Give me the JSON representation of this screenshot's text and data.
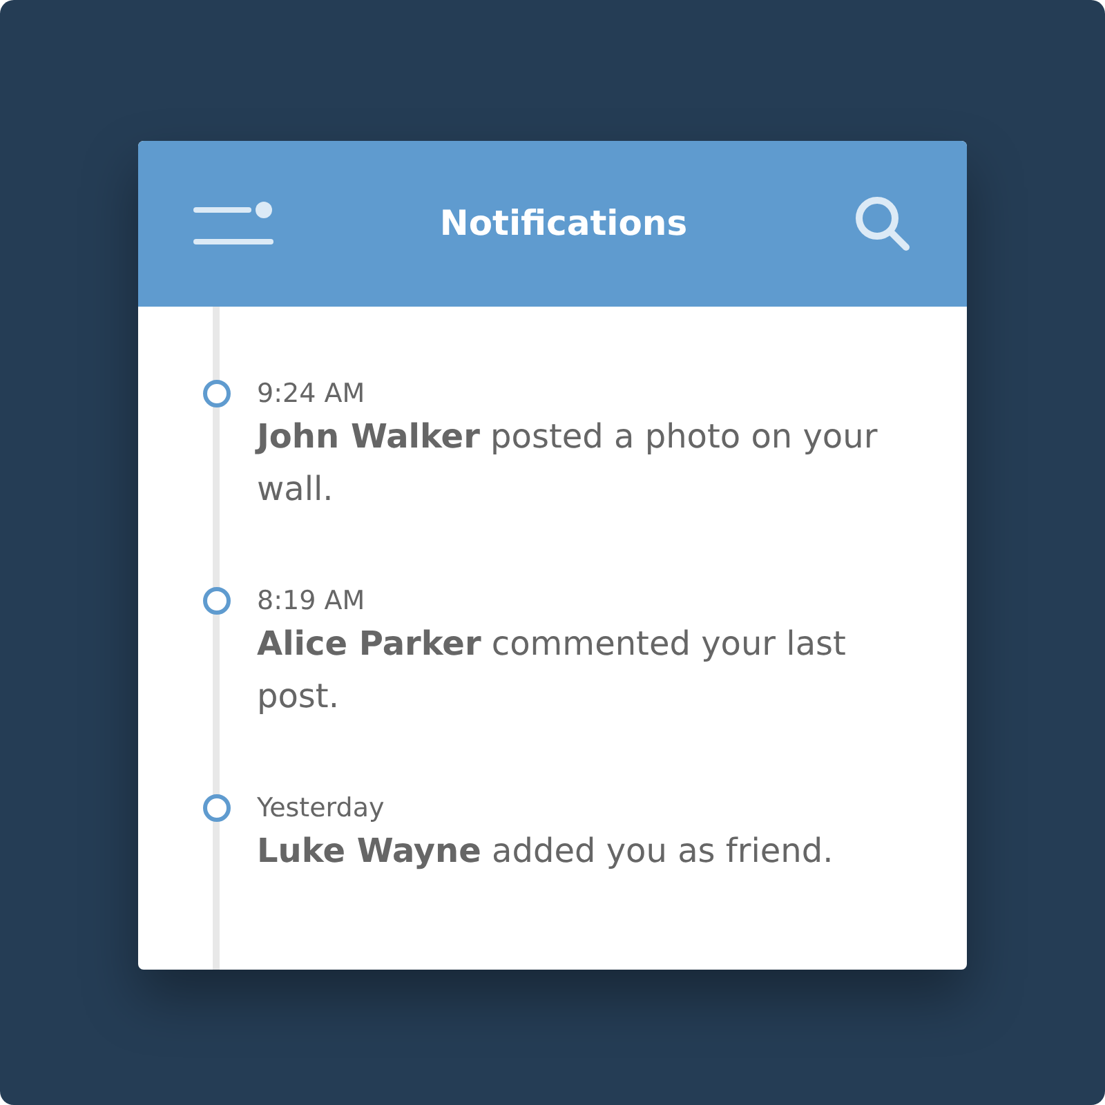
{
  "header": {
    "title": "Notifications"
  },
  "notifications": [
    {
      "time": "9:24 AM",
      "message": "**John Walker** posted a photo on your wall."
    },
    {
      "time": "8:19 AM",
      "message": "**Alice Parker** commented your last post."
    },
    {
      "time": "Yesterday",
      "message": "**Luke Wayne** added you as friend."
    }
  ]
}
